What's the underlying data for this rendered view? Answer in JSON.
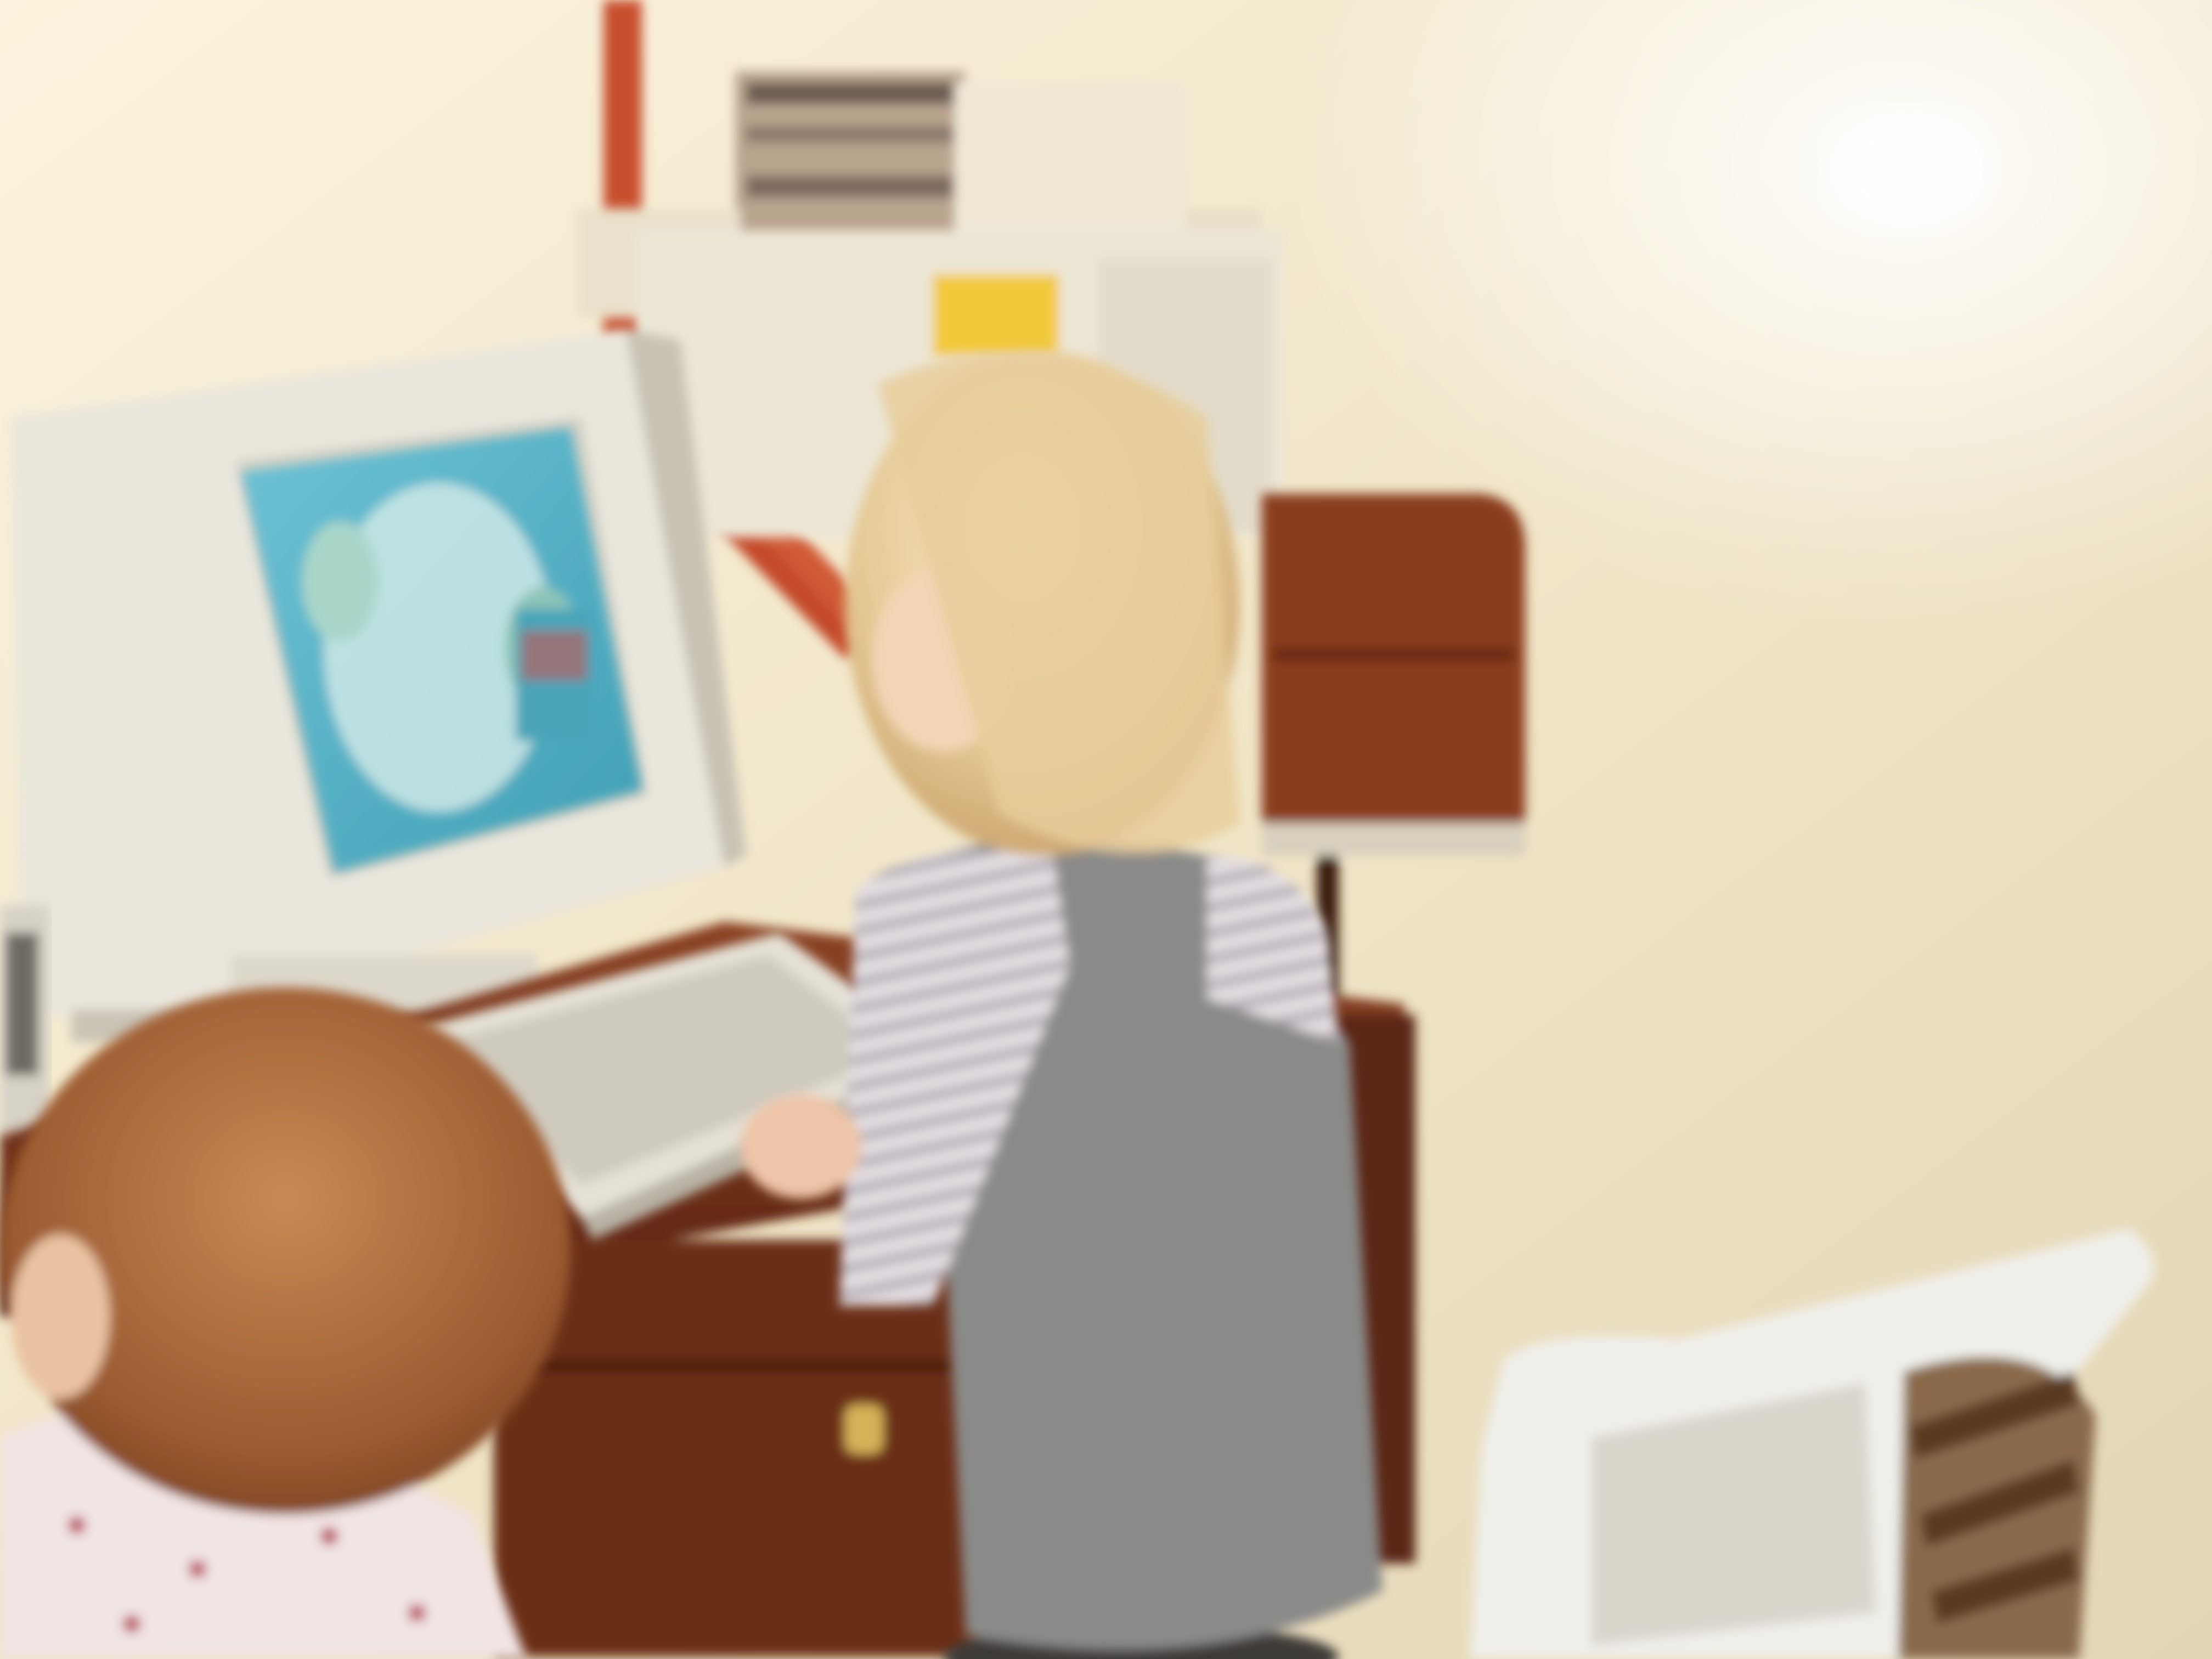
{
  "photo": {
    "subject": "photo",
    "palette": {
      "wall_light": "#f6eed8",
      "wall_shadow": "#e2d8bd",
      "pole_red": "#c8502e",
      "monitor_beige": "#e9e6dc",
      "screen_blue": "#5fb3c9",
      "screen_inner": "#cfe9e6",
      "desk_brown": "#7a351c",
      "keyboard_beige": "#e4e1d6",
      "hair_blond": "#e7cfa3",
      "hair_red": "#a9683c",
      "shirt_stripe": "#dcd8dc",
      "overalls_grey": "#8a8a88",
      "chair_white": "#efefea",
      "sticker_yellow": "#f2c93b"
    }
  }
}
